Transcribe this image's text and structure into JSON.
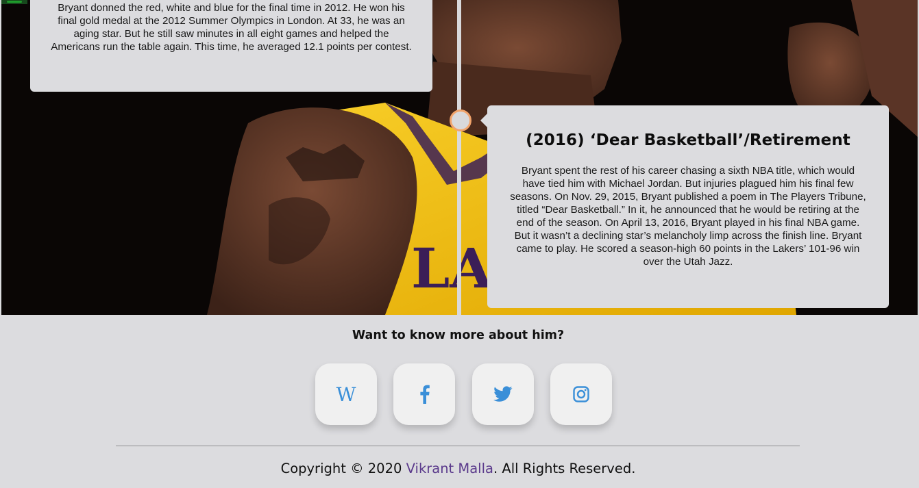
{
  "timeline": {
    "olympics_card": {
      "text": "Bryant donned the red, white and blue for the final time in 2012. He won his final gold medal at the 2012 Summer Olympics in London. At 33, he was an aging star. But he still saw minutes in all eight games and helped the Americans run the table again. This time, he averaged 12.1 points per contest."
    },
    "retirement_card": {
      "title": "(2016) ‘Dear Basketball’/Retirement",
      "text": "Bryant spent the rest of his career chasing a sixth NBA title, which would have tied him with Michael Jordan. But injuries plagued him his final few seasons. On Nov. 29, 2015, Bryant published a poem in The Players Tribune, titled “Dear Basketball.” In it, he announced that he would be retiring at the end of the season. On April 13, 2016, Bryant played in his final NBA game. But it wasn’t a declining star’s melancholy limp across the finish line. Bryant came to play. He scored a season-high 60 points in the Lakers’ 101-96 win over the Utah Jazz."
    },
    "jersey_text": "LAK"
  },
  "footer": {
    "heading": "Want to know more about him?",
    "social": [
      {
        "name": "wikipedia",
        "glyph": "W",
        "icon": "wikipedia-icon"
      },
      {
        "name": "facebook",
        "icon": "facebook-icon"
      },
      {
        "name": "twitter",
        "icon": "twitter-icon"
      },
      {
        "name": "instagram",
        "icon": "instagram-icon"
      }
    ],
    "copyright_prefix": "Copyright © 2020 ",
    "author": "Vikrant Malla",
    "copyright_suffix": ". All Rights Reserved."
  },
  "colors": {
    "accent": "#3a8fd8",
    "link": "#5b3a8c",
    "timeline_dot_border": "#f2a46b",
    "background": "#dcdcdf"
  }
}
